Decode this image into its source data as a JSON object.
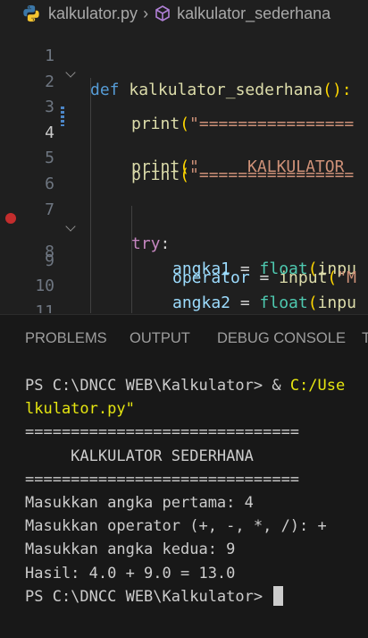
{
  "breadcrumb": {
    "file": "kalkulator.py",
    "symbol": "kalkulator_sederhana"
  },
  "editor": {
    "active_line": 4,
    "lines": [
      {
        "num": "1"
      },
      {
        "num": "2"
      },
      {
        "num": "3"
      },
      {
        "num": "4"
      },
      {
        "num": "5"
      },
      {
        "num": "6"
      },
      {
        "num": "7"
      },
      {
        "num": "8"
      },
      {
        "num": "9"
      },
      {
        "num": "10"
      },
      {
        "num": "11"
      }
    ],
    "code": {
      "l1_kw": "def",
      "l1_fn": "kalkulator_sederhana",
      "l1_paren": "():",
      "l3_fn": "print",
      "l3_open": "(",
      "l3_str": "\"================",
      "l4_fn": "print",
      "l4_open": "(",
      "l4_str": "\"     KALKULATOR",
      "l5_fn": "print",
      "l5_open": "(",
      "l5_str": "\"================",
      "l7_kw": "try",
      "l7_colon": ":",
      "l8_var": "angka1",
      "l8_eq": " = ",
      "l8_bi": "float",
      "l8_open": "(",
      "l8_fn": "inpu",
      "l9_var": "operator",
      "l9_eq": " = ",
      "l9_fn": "input",
      "l9_open": "(",
      "l9_str": "\"M",
      "l10_var": "angka2",
      "l10_eq": " = ",
      "l10_bi": "float",
      "l10_open": "(",
      "l10_fn": "inpu"
    }
  },
  "panel": {
    "tabs": [
      "PROBLEMS",
      "OUTPUT",
      "DEBUG CONSOLE",
      "T"
    ]
  },
  "terminal": {
    "prompt1": "PS C:\\DNCC WEB\\Kalkulator> & ",
    "cmd_path": "C:/Use",
    "cont": "lkulator.py\"",
    "rule1": "==============================",
    "title": "     KALKULATOR SEDERHANA",
    "rule2": "==============================",
    "out1": "Masukkan angka pertama: 4",
    "out2": "Masukkan operator (+, -, *, /): +",
    "out3": "Masukkan angka kedua: 9",
    "out4": "Hasil: 4.0 + 9.0 = 13.0",
    "prompt2": "PS C:\\DNCC WEB\\Kalkulator> "
  },
  "colors": {
    "editor_bg": "#1f1f1f",
    "panel_bg": "#181818",
    "keyword": "#569cd6",
    "control_keyword": "#c586c0",
    "function": "#dcdcaa",
    "builtin": "#4ec9b0",
    "variable": "#9cdcfe",
    "string": "#ce9178",
    "bracket": "#ffd700",
    "terminal_yellow": "#e5e510",
    "breakpoint": "#c32d2d"
  },
  "icons": [
    "python-icon",
    "chevron-right-icon",
    "symbol-method-icon",
    "fold-chevron-icon",
    "breakpoint-icon"
  ]
}
